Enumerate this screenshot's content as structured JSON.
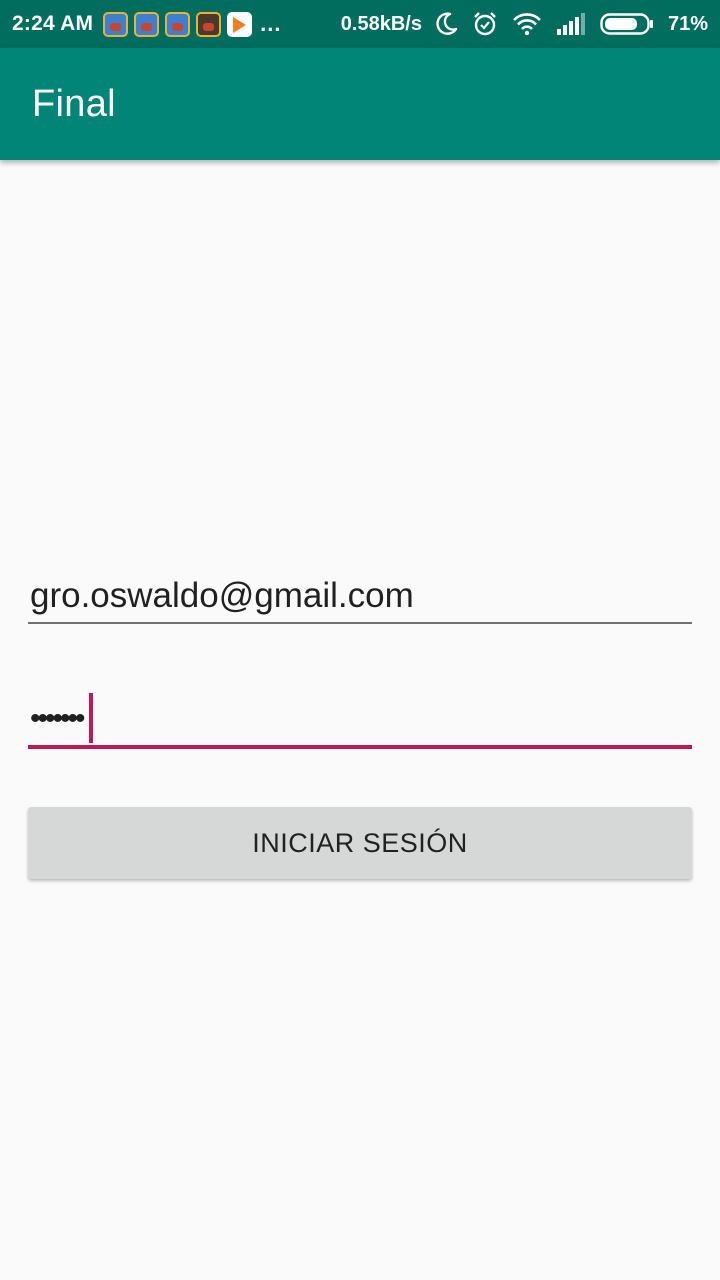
{
  "status_bar": {
    "time": "2:24 AM",
    "notification_icons": [
      "clash-royale-icon",
      "clash-royale-icon",
      "clash-royale-icon",
      "clash-royale-dark-icon",
      "google-play-icon"
    ],
    "more": "...",
    "network_speed": "0.58kB/s",
    "battery_percent": "71%"
  },
  "app_bar": {
    "title": "Final"
  },
  "form": {
    "email_value": "gro.oswaldo@gmail.com",
    "password_masked": "•••••••",
    "login_label": "INICIAR SESIÓN"
  },
  "colors": {
    "status_bar": "#006d5f",
    "app_bar": "#008577",
    "accent": "#c2185b",
    "button": "#d6d7d7",
    "background": "#fafafa"
  }
}
